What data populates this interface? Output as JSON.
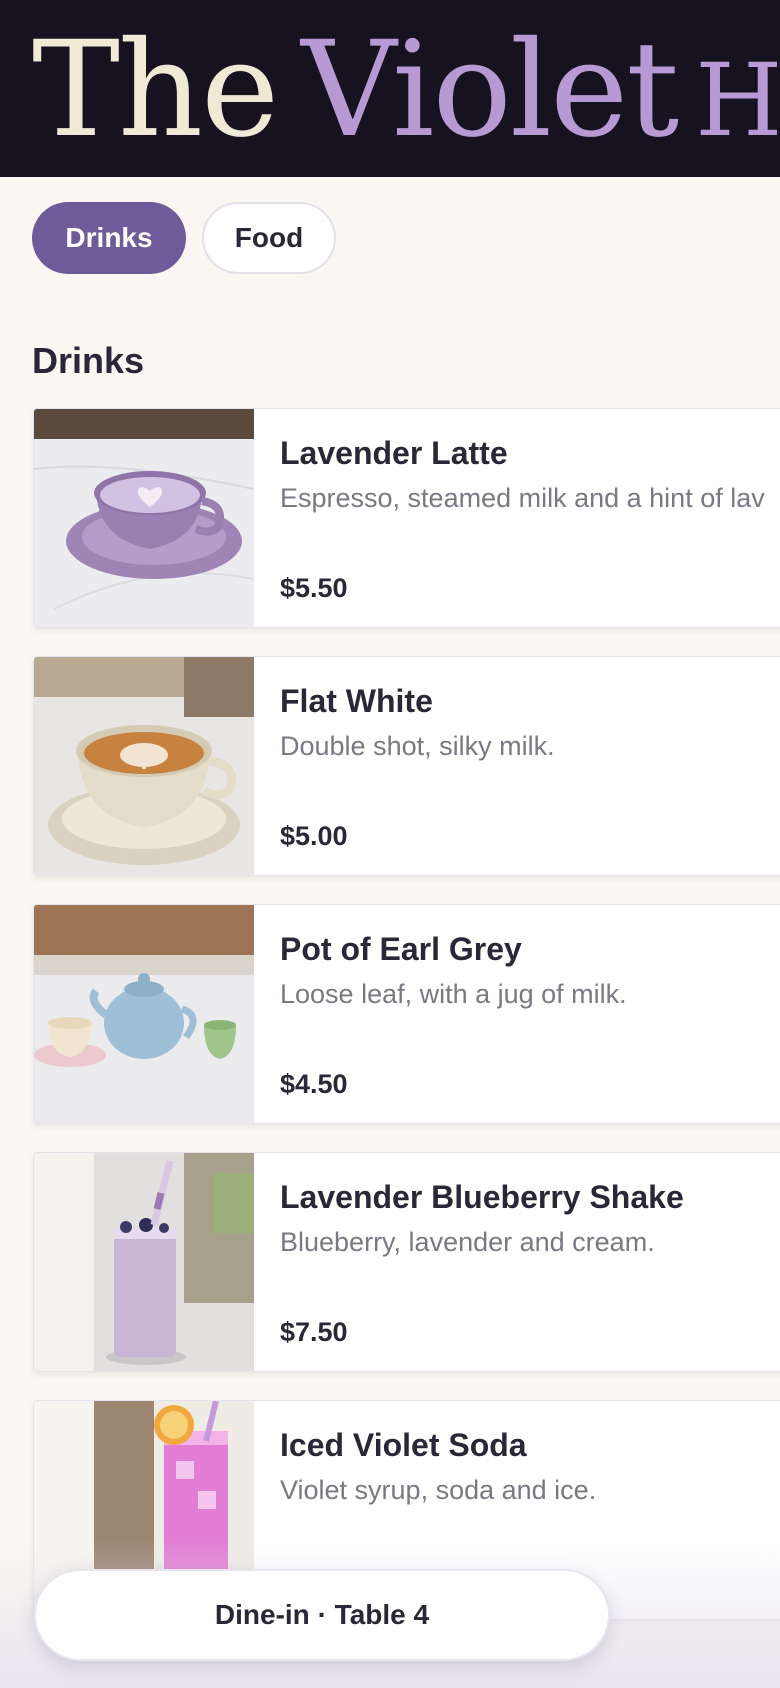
{
  "brand": {
    "word1": "The",
    "word2": "Violet",
    "word3": "HOU"
  },
  "tabs": [
    {
      "label": "Drinks",
      "active": true
    },
    {
      "label": "Food",
      "active": false
    }
  ],
  "section": {
    "title": "Drinks"
  },
  "items": [
    {
      "name": "Lavender Latte",
      "description": "Espresso, steamed milk and a hint of lav",
      "price": "$5.50",
      "image": "lavender-latte"
    },
    {
      "name": "Flat White",
      "description": "Double shot, silky milk.",
      "price": "$5.00",
      "image": "flat-white"
    },
    {
      "name": "Pot of Earl Grey",
      "description": "Loose leaf, with a jug of milk.",
      "price": "$4.50",
      "image": "earl-grey-teapot"
    },
    {
      "name": "Lavender Blueberry Shake",
      "description": "Blueberry, lavender and cream.",
      "price": "$7.50",
      "image": "blueberry-shake"
    },
    {
      "name": "Iced Violet Soda",
      "description": "Violet syrup, soda and ice.",
      "price": "",
      "image": "violet-soda"
    }
  ],
  "order": {
    "label": "Dine-in · Table 4"
  },
  "colors": {
    "header_bg": "#16121f",
    "accent": "#6e5b9a",
    "brand_cream": "#efe9d6",
    "brand_violet": "#b79ad3",
    "page_bg": "#faf7f2"
  }
}
